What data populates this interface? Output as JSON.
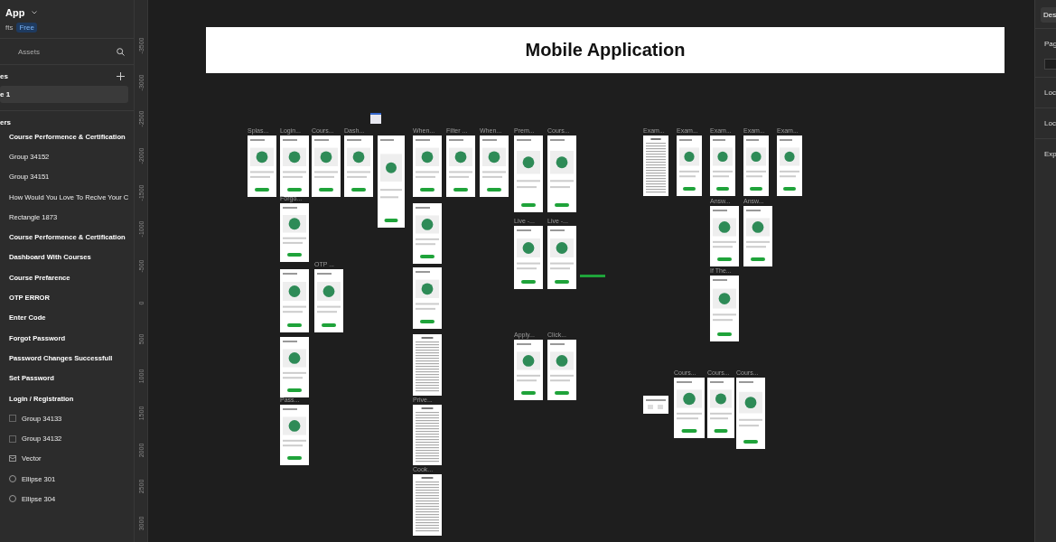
{
  "file": {
    "name": "App",
    "plan": "fts",
    "badge": "Free"
  },
  "panel_tabs": [
    {
      "label": "Assets",
      "selected": false
    }
  ],
  "pages": {
    "title": "es",
    "items": [
      {
        "label": "e 1",
        "selected": true
      }
    ]
  },
  "layers": {
    "title": "ers",
    "items": [
      {
        "label": "Course Performence & Certification",
        "kind": "frame"
      },
      {
        "label": "Group 34152",
        "kind": "layer"
      },
      {
        "label": "Group 34151",
        "kind": "layer"
      },
      {
        "label": "How Would You Love To Recive Your C",
        "kind": "layer"
      },
      {
        "label": "Rectangle 1873",
        "kind": "layer"
      },
      {
        "label": "Course Performence & Certification",
        "kind": "frame"
      },
      {
        "label": "Dashboard With Courses",
        "kind": "frame"
      },
      {
        "label": "Course Prefarence",
        "kind": "frame"
      },
      {
        "label": "OTP ERROR",
        "kind": "frame"
      },
      {
        "label": "Enter Code",
        "kind": "frame"
      },
      {
        "label": "Forgot Password",
        "kind": "frame"
      },
      {
        "label": "Password Changes Successfull",
        "kind": "frame"
      },
      {
        "label": "Set Password",
        "kind": "frame"
      },
      {
        "label": "Login / Registration",
        "kind": "frame"
      },
      {
        "label": "Group 34133",
        "kind": "group"
      },
      {
        "label": "Group 34132",
        "kind": "group"
      },
      {
        "label": "Vector",
        "kind": "vector"
      },
      {
        "label": "Ellipse 301",
        "kind": "ellipse"
      },
      {
        "label": "Ellipse 304",
        "kind": "ellipse"
      }
    ]
  },
  "ruler": [
    "-3500",
    "-3000",
    "-2500",
    "-2000",
    "-1500",
    "-1000",
    "-500",
    "0",
    "500",
    "1000",
    "1500",
    "2000",
    "2500",
    "3000"
  ],
  "canvas": {
    "title": "Mobile Application",
    "frames": [
      {
        "label": "Splas...",
        "kind": "screen"
      },
      {
        "label": "Login...",
        "kind": "screen"
      },
      {
        "label": "Cours...",
        "kind": "screen"
      },
      {
        "label": "Dash...",
        "kind": "screen"
      },
      {
        "kind": "screen"
      },
      {
        "label": "When...",
        "kind": "screen"
      },
      {
        "label": "Filter ...",
        "kind": "screen"
      },
      {
        "label": "When...",
        "kind": "screen"
      },
      {
        "label": "Prem...",
        "kind": "screen"
      },
      {
        "label": "Cours...",
        "kind": "screen"
      },
      {
        "label": "Exam...",
        "kind": "document"
      },
      {
        "label": "Exam...",
        "kind": "screen"
      },
      {
        "label": "Exam...",
        "kind": "screen"
      },
      {
        "label": "Exam...",
        "kind": "screen"
      },
      {
        "label": "Exam...",
        "kind": "screen"
      },
      {
        "label": "Forgo...",
        "kind": "screen"
      },
      {
        "kind": "screen"
      },
      {
        "kind": "screen"
      },
      {
        "label": "Live -...",
        "kind": "screen"
      },
      {
        "label": "Live -...",
        "kind": "screen"
      },
      {
        "label": "Answ...",
        "kind": "screen"
      },
      {
        "label": "Answ...",
        "kind": "screen"
      },
      {
        "label": "If The...",
        "kind": "screen"
      },
      {
        "kind": "screen"
      },
      {
        "label": "OTP ...",
        "kind": "screen"
      },
      {
        "kind": "document"
      },
      {
        "label": "Prive...",
        "kind": "document"
      },
      {
        "label": "Cook...",
        "kind": "document"
      },
      {
        "kind": "screen"
      },
      {
        "label": "Pass...",
        "kind": "screen"
      },
      {
        "label": "Apply...",
        "kind": "screen"
      },
      {
        "label": "Click...",
        "kind": "screen"
      },
      {
        "label": "Cours...",
        "kind": "screen"
      },
      {
        "label": "Cours...",
        "kind": "screen"
      },
      {
        "label": "Cours...",
        "kind": "screen"
      },
      {
        "kind": "card"
      }
    ]
  },
  "right_panel": {
    "tabs": [
      {
        "label": "Des",
        "selected": true
      }
    ],
    "sections": [
      "Pag",
      "Loc",
      "Loc",
      "Exp"
    ]
  }
}
